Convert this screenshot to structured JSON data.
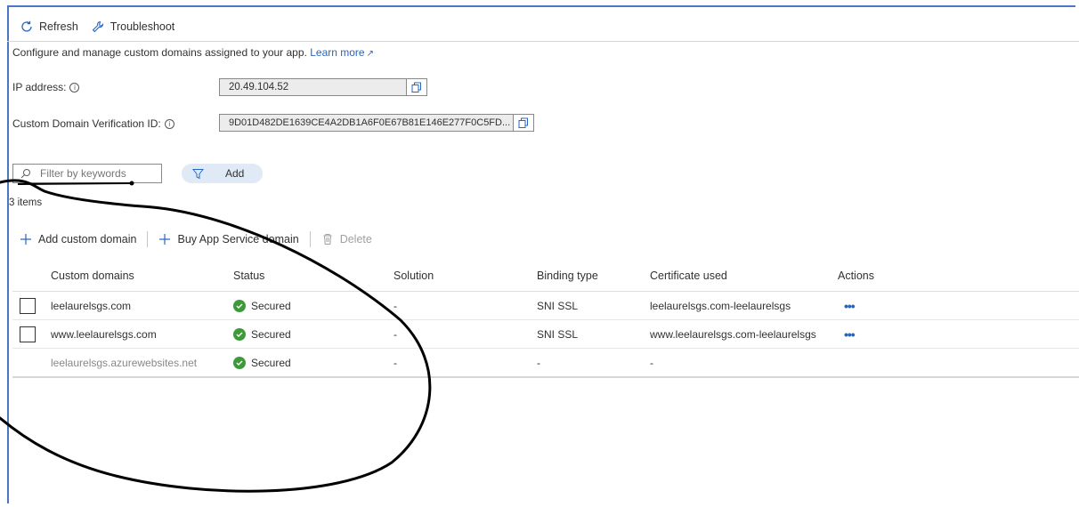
{
  "toolbar": {
    "refresh_label": "Refresh",
    "troubleshoot_label": "Troubleshoot"
  },
  "description": {
    "text": "Configure and manage custom domains assigned to your app.",
    "link": "Learn more"
  },
  "ip": {
    "label": "IP address:",
    "value": "20.49.104.52"
  },
  "verification": {
    "label": "Custom Domain Verification ID:",
    "value": "9D01D482DE1639CE4A2DB1A6F0E67B81E146E277F0C5FD..."
  },
  "filter": {
    "placeholder": "Filter by keywords",
    "add_label": "Add"
  },
  "items_count": "3 items",
  "actions": {
    "add_custom_domain": "Add custom domain",
    "buy_domain": "Buy App Service domain",
    "delete": "Delete"
  },
  "table": {
    "headers": [
      "Custom domains",
      "Status",
      "Solution",
      "Binding type",
      "Certificate used",
      "Actions"
    ],
    "rows": [
      {
        "domain": "leelaurelsgs.com",
        "status": "Secured",
        "solution": "-",
        "binding": "SNI SSL",
        "certificate": "leelaurelsgs.com-leelaurelsgs",
        "actions": "•••"
      },
      {
        "domain": "www.leelaurelsgs.com",
        "status": "Secured",
        "solution": "-",
        "binding": "SNI SSL",
        "certificate": "www.leelaurelsgs.com-leelaurelsgs",
        "actions": "•••"
      },
      {
        "domain": "leelaurelsgs.azurewebsites.net",
        "status": "Secured",
        "solution": "-",
        "binding": "-",
        "certificate": "-",
        "actions": ""
      }
    ]
  },
  "colors": {
    "accent": "#2566c5",
    "success": "#3d9a3a",
    "frame": "#4a78c0"
  }
}
